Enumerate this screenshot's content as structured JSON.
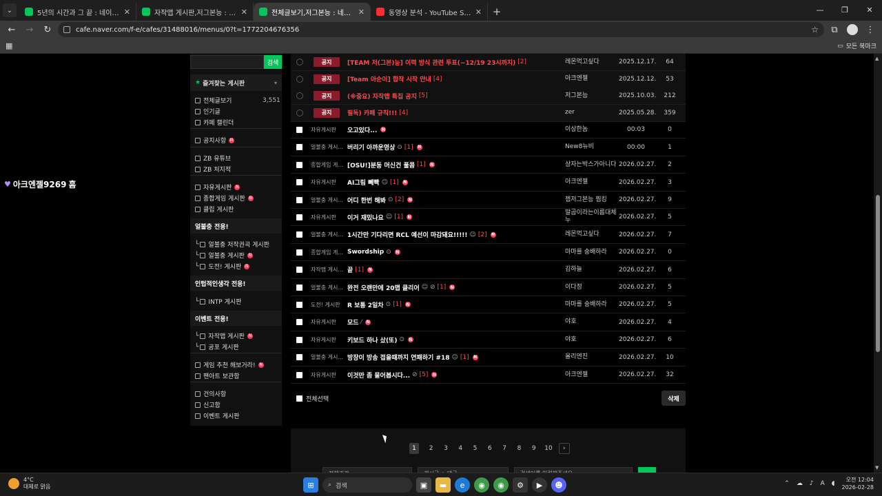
{
  "browser": {
    "tabs": [
      {
        "title": "5년의 시간과 그 끝 : 네이버 카",
        "active": false,
        "icon": "naver-cafe"
      },
      {
        "title": "자작맵 게시판,저그본능 : 네이버",
        "active": false,
        "icon": "naver-cafe"
      },
      {
        "title": "전체글보기,저그본능 : 네이버",
        "active": true,
        "icon": "naver-cafe"
      },
      {
        "title": "동영상 분석 - YouTube Studio",
        "active": false,
        "icon": "youtube"
      }
    ],
    "url": "cafe.naver.com/f-e/cafes/31488016/menus/0?t=1772204676356",
    "bookmarks_label": "모든 북마크"
  },
  "overlay": {
    "username": "아크엔젤9269",
    "suffix": "흠"
  },
  "sidebar": {
    "search_button": "검색",
    "favorites_title": "즐겨찾는 게시판",
    "items_top": [
      {
        "label": "전체글보기",
        "count": "3,551"
      },
      {
        "label": "인기글"
      },
      {
        "label": "카페 캘린더"
      }
    ],
    "notice": "공지사항",
    "zb": [
      "ZB 유튜브",
      "ZB 처지적"
    ],
    "boards": [
      "자유게시판",
      "종합게임 게시판",
      "클립 게시판"
    ],
    "section1_title": "얼불충 전용!",
    "section1_items": [
      "얼불충 저작권곡 게시판",
      "얼불충 게시판",
      "도전! 게시판"
    ],
    "section2_title": "인텁적인생각 전용!",
    "section2_items": [
      "INTP 게시판"
    ],
    "section3_title": "이벤트 전용!",
    "section3_items": [
      "자작맵 게시판",
      "공포 게시판"
    ],
    "misc1": [
      "게임 추천 해보거라!",
      "팬아트 보관함"
    ],
    "misc2": [
      "건의사항",
      "신고함",
      "이벤트 게시판"
    ]
  },
  "notices": [
    {
      "badge": "공지",
      "title": "[TEAM 저(그본)능] 이력 방식 관련 투표(~12/19 23시까지)",
      "comments": "[2]",
      "author": "레몬먹고싶다",
      "date": "2025.12.17.",
      "views": "64"
    },
    {
      "badge": "공지",
      "title": "[Team 아순이] 합작 시작 안내",
      "comments": "[4]",
      "author": "아크엔젤",
      "date": "2025.12.12.",
      "views": "53"
    },
    {
      "badge": "공지",
      "title": "(※중요) 자작맵 특집 공지",
      "comments": "[5]",
      "author": "저그본능",
      "date": "2025.10.03.",
      "views": "212"
    },
    {
      "badge": "공지",
      "title": "필독) 카페 규칙!!!",
      "comments": "[4]",
      "author": "zer",
      "date": "2025.05.28.",
      "views": "359"
    }
  ],
  "posts": [
    {
      "board": "자유게시판",
      "title": "오고있다...",
      "comments": "",
      "icon": "",
      "author": "이상한놈",
      "date": "00:03",
      "views": "0"
    },
    {
      "board": "얼불충 게시...",
      "title": "버리기 아까운영상",
      "comments": "[1]",
      "icon": "⊙",
      "author": "New8뉴비",
      "date": "00:00",
      "views": "1"
    },
    {
      "board": "종합게임 게...",
      "title": "[OSU!]분동 머신건 풀콤",
      "comments": "[1]",
      "icon": "",
      "author": "상자는박스가아니다",
      "date": "2026.02.27.",
      "views": "2"
    },
    {
      "board": "자유게시판",
      "title": "AI그림 뻬빡",
      "comments": "[1]",
      "icon": "☺",
      "author": "아크엔젤",
      "date": "2026.02.27.",
      "views": "3"
    },
    {
      "board": "얼불충 게시...",
      "title": "어디 한번 해봐",
      "comments": "[2]",
      "icon": "⊙",
      "author": "젭저그본능 찜킹",
      "date": "2026.02.27.",
      "views": "9"
    },
    {
      "board": "자유게시판",
      "title": "이거 재밌나요",
      "comments": "[1]",
      "icon": "☺",
      "author": "말곰이라는이름대체누",
      "date": "2026.02.27.",
      "views": "5"
    },
    {
      "board": "얼불충 게시...",
      "title": "1시간만 기다리면 RCL 예선이 마감돼요!!!!!",
      "comments": "[2]",
      "icon": "☺",
      "author": "레몬먹고싶다",
      "date": "2026.02.27.",
      "views": "7"
    },
    {
      "board": "종합게임 게...",
      "title": "Swordship",
      "comments": "",
      "icon": "⊙",
      "author": "마마를 숭배하라",
      "date": "2026.02.27.",
      "views": "0"
    },
    {
      "board": "자작맵 게시...",
      "title": "끝",
      "comments": "[1]",
      "icon": "",
      "author": "김하늘",
      "date": "2026.02.27.",
      "views": "6"
    },
    {
      "board": "얼불충 게시...",
      "title": "완전 오랜만에 20맵 클리어",
      "comments": "[1]",
      "icon": "☺ ⊘",
      "author": "이다정",
      "date": "2026.02.27.",
      "views": "5"
    },
    {
      "board": "도전! 게시판",
      "title": "R 보통 2일차",
      "comments": "[1]",
      "icon": "⊙",
      "author": "마마를 숭배하라",
      "date": "2026.02.27.",
      "views": "5"
    },
    {
      "board": "자유게시판",
      "title": "모드",
      "comments": "",
      "icon": "⁄",
      "author": "야호",
      "date": "2026.02.27.",
      "views": "4"
    },
    {
      "board": "자유게시판",
      "title": "키보드 하나 샀(또)",
      "comments": "",
      "icon": "⊙",
      "author": "야호",
      "date": "2026.02.27.",
      "views": "6"
    },
    {
      "board": "얼불충 게시...",
      "title": "방장이 방송 접을때까지 연패하기 #18",
      "comments": "[1]",
      "icon": "☺",
      "author": "올리엔진",
      "date": "2026.02.27.",
      "views": "10"
    },
    {
      "board": "자유게시판",
      "title": "이것만 좀 물어봅시다...",
      "comments": "[5]",
      "icon": "⊘",
      "author": "아크엔젤",
      "date": "2026.02.27.",
      "views": "32"
    }
  ],
  "controls": {
    "select_all": "전체선택",
    "delete": "삭제"
  },
  "pagination": {
    "pages": [
      "1",
      "2",
      "3",
      "4",
      "5",
      "6",
      "7",
      "8",
      "9",
      "10"
    ],
    "current": "1",
    "next": "›"
  },
  "filters": {
    "period": "전체기간",
    "scope": "게시글 + 댓글",
    "placeholder": "검색어를 입력해주세요"
  },
  "taskbar": {
    "temp": "4°C",
    "weather": "대체로 맑음",
    "search": "검색",
    "time": "오전 12:04",
    "date": "2026-02-28"
  },
  "colors": {
    "accent": "#03c75a",
    "notice": "#8b1c2c",
    "comment": "#ff4d4d"
  }
}
